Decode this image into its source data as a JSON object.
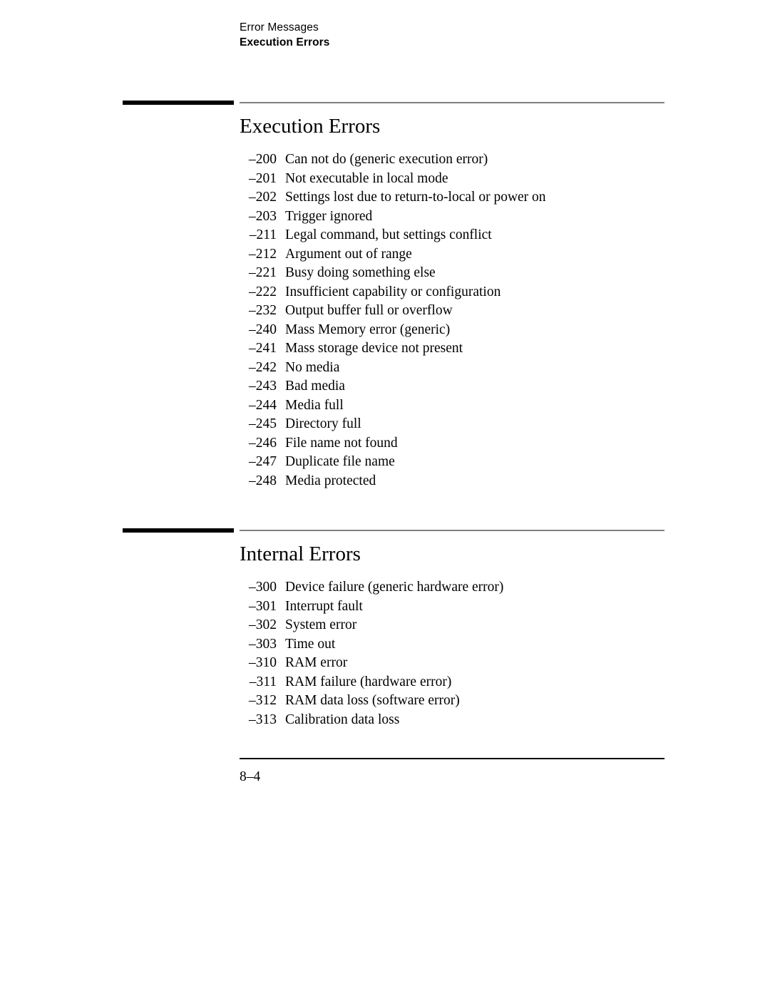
{
  "header": {
    "chapter_title": "Error Messages",
    "section_title": "Execution Errors"
  },
  "sections": [
    {
      "heading": "Execution Errors",
      "items": [
        {
          "code": "–200",
          "text": "Can not do (generic execution error)"
        },
        {
          "code": "–201",
          "text": "Not executable in local mode"
        },
        {
          "code": "–202",
          "text": "Settings lost due to return-to-local or power on"
        },
        {
          "code": "–203",
          "text": "Trigger ignored"
        },
        {
          "code": "–211",
          "text": "Legal command, but settings conflict"
        },
        {
          "code": "–212",
          "text": "Argument out of range"
        },
        {
          "code": "–221",
          "text": "Busy doing something else"
        },
        {
          "code": "–222",
          "text": "Insufficient capability or configuration"
        },
        {
          "code": "–232",
          "text": "Output buffer full or overflow"
        },
        {
          "code": "–240",
          "text": "Mass Memory error (generic)"
        },
        {
          "code": "–241",
          "text": "Mass storage device not present"
        },
        {
          "code": "–242",
          "text": "No media"
        },
        {
          "code": "–243",
          "text": "Bad media"
        },
        {
          "code": "–244",
          "text": "Media full"
        },
        {
          "code": "–245",
          "text": "Directory full"
        },
        {
          "code": "–246",
          "text": "File name not found"
        },
        {
          "code": "–247",
          "text": "Duplicate file name"
        },
        {
          "code": "–248",
          "text": "Media protected"
        }
      ]
    },
    {
      "heading": "Internal Errors",
      "items": [
        {
          "code": "–300",
          "text": "Device failure (generic hardware error)"
        },
        {
          "code": "–301",
          "text": "Interrupt fault"
        },
        {
          "code": "–302",
          "text": "System error"
        },
        {
          "code": "–303",
          "text": "Time out"
        },
        {
          "code": "–310",
          "text": "RAM error"
        },
        {
          "code": "–311",
          "text": "RAM failure (hardware error)"
        },
        {
          "code": "–312",
          "text": "RAM data loss (software error)"
        },
        {
          "code": "–313",
          "text": "Calibration data loss"
        }
      ]
    }
  ],
  "footer": {
    "page_number": "8–4"
  },
  "colors": {
    "text": "#000000",
    "rule_thin": "#808080",
    "rule_thick": "#000000",
    "background": "#ffffff"
  }
}
